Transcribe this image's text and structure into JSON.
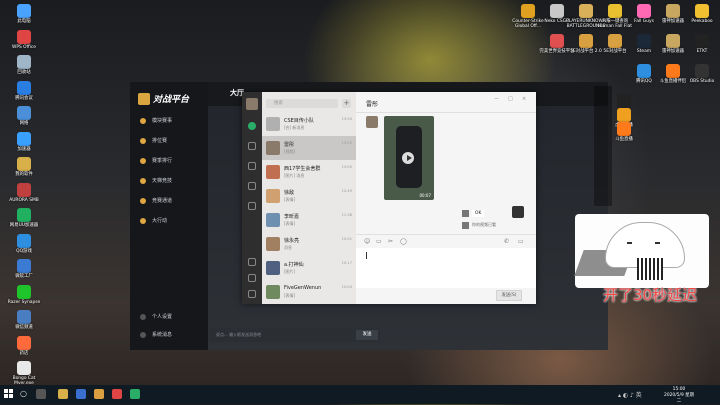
{
  "desktop_left": [
    {
      "label": "此电脑",
      "color": "#4aa3ff"
    },
    {
      "label": "WPS Office",
      "color": "#e04545"
    },
    {
      "label": "回收站",
      "color": "#9fb6c8"
    },
    {
      "label": "腾讯会议",
      "color": "#2a7de1"
    },
    {
      "label": "网络",
      "color": "#4a8fd8"
    },
    {
      "label": "加速器",
      "color": "#3aa0ff"
    },
    {
      "label": "我的软件",
      "color": "#d8b04a"
    },
    {
      "label": "AURORA SMB",
      "color": "#c04040"
    },
    {
      "label": "网易UU加速器",
      "color": "#21b060"
    },
    {
      "label": "QQ游戏",
      "color": "#2e8fe0"
    },
    {
      "label": "微软工厂",
      "color": "#3b7bd4"
    },
    {
      "label": "Razer Synapse",
      "color": "#1fc42b"
    },
    {
      "label": "微信频道",
      "color": "#4a7ec2"
    },
    {
      "label": "药店",
      "color": "#ff6a3d"
    },
    {
      "label": "Bongo Cat Mver.exe",
      "color": "#e8e8e8"
    }
  ],
  "desktop_top": [
    {
      "label": "Counter-Strike Global Off...",
      "color": "#e0a020"
    },
    {
      "label": "Neko CSGO",
      "color": "#c8c8c8"
    },
    {
      "label": "PLAYERUNKNOWN'S BATTLEGROUNDS",
      "color": "#d8b05a"
    },
    {
      "label": "人形一键查询 Human Fall Flat",
      "color": "#e8c030"
    },
    {
      "label": "Fall Guys",
      "color": "#ff69b4"
    },
    {
      "label": "雷神加速器",
      "color": "#c8a860"
    },
    {
      "label": "Peekaboo",
      "color": "#f0c030"
    }
  ],
  "desktop_top2": [
    {
      "label": "完美世界竞技平台",
      "color": "#e05050"
    },
    {
      "label": "5E对战平台 2.0",
      "color": "#d8a040"
    },
    {
      "label": "5E对战平台",
      "color": "#d8a040"
    },
    {
      "label": "Steam",
      "color": "#1b2838"
    },
    {
      "label": "雷神加速器",
      "color": "#c8a860"
    },
    {
      "label": "ETKT",
      "color": "#222222"
    }
  ],
  "desktop_top3": [
    {
      "label": "腾讯QQ",
      "color": "#2e8fe0"
    },
    {
      "label": "斗鱼直播伴侣",
      "color": "#ff7a1a"
    },
    {
      "label": "OBS Studio",
      "color": "#333333"
    }
  ],
  "desktop_right_col": [
    {
      "label": "Game",
      "color": "#222222"
    },
    {
      "label": "虎牙直播",
      "color": "#f0a020"
    },
    {
      "label": "斗鱼直播",
      "color": "#ff7a1a"
    }
  ],
  "app": {
    "logo_text": "对战平台",
    "tabs": [
      "大厅",
      "",
      "",
      ""
    ],
    "nav": [
      "模块赛事",
      "排位赛",
      "赛季排行",
      "天梯竞技",
      "竞赛通道",
      "大行动"
    ],
    "bottom_nav": [
      "个人设置",
      "系统消息"
    ],
    "chat_placeholder": "说点... 输入框发送消息吧",
    "send_label": "发送"
  },
  "wechat": {
    "search_placeholder": "搜索",
    "plus": "+",
    "title": "雷彤",
    "controls": [
      "—",
      "□",
      "×"
    ],
    "conversations": [
      {
        "name": "CSE目传小队",
        "preview": "[合] 新消息",
        "time": "13:50",
        "color": "#b0b0b0",
        "active": false
      },
      {
        "name": "雷彤",
        "preview": "[视频]",
        "time": "13:52",
        "color": "#8a7a6a",
        "active": true
      },
      {
        "name": "西17学生会舍群",
        "preview": "[图片] 消息",
        "time": "13:05",
        "color": "#c07050",
        "active": false
      },
      {
        "name": "徐敌",
        "preview": "[表情]",
        "time": "12:49",
        "color": "#d0a070",
        "active": false
      },
      {
        "name": "李昕嘉",
        "preview": "[表情]",
        "time": "11:38",
        "color": "#6f8fb0",
        "active": false
      },
      {
        "name": "徐永亮",
        "preview": "消息",
        "time": "10:51",
        "color": "#a08060",
        "active": false
      },
      {
        "name": "a.打神仙",
        "preview": "[图片]",
        "time": "10:17",
        "color": "#506080",
        "active": false
      },
      {
        "name": "FiveGenWenun",
        "preview": "[表情]",
        "time": "10:04",
        "color": "#708a60",
        "active": false
      }
    ],
    "video_duration": "00:07",
    "reply_ok": "OK",
    "reply_sub": "你的视频已看",
    "tools": [
      "☺",
      "▭",
      "✂",
      "◯",
      "✆",
      "▭"
    ],
    "send_label": "发送(S)"
  },
  "overlay": {
    "delay_text": "开了30秒延迟"
  },
  "taskbar": {
    "time": "15:00",
    "date": "2020/5/9 星期二"
  }
}
